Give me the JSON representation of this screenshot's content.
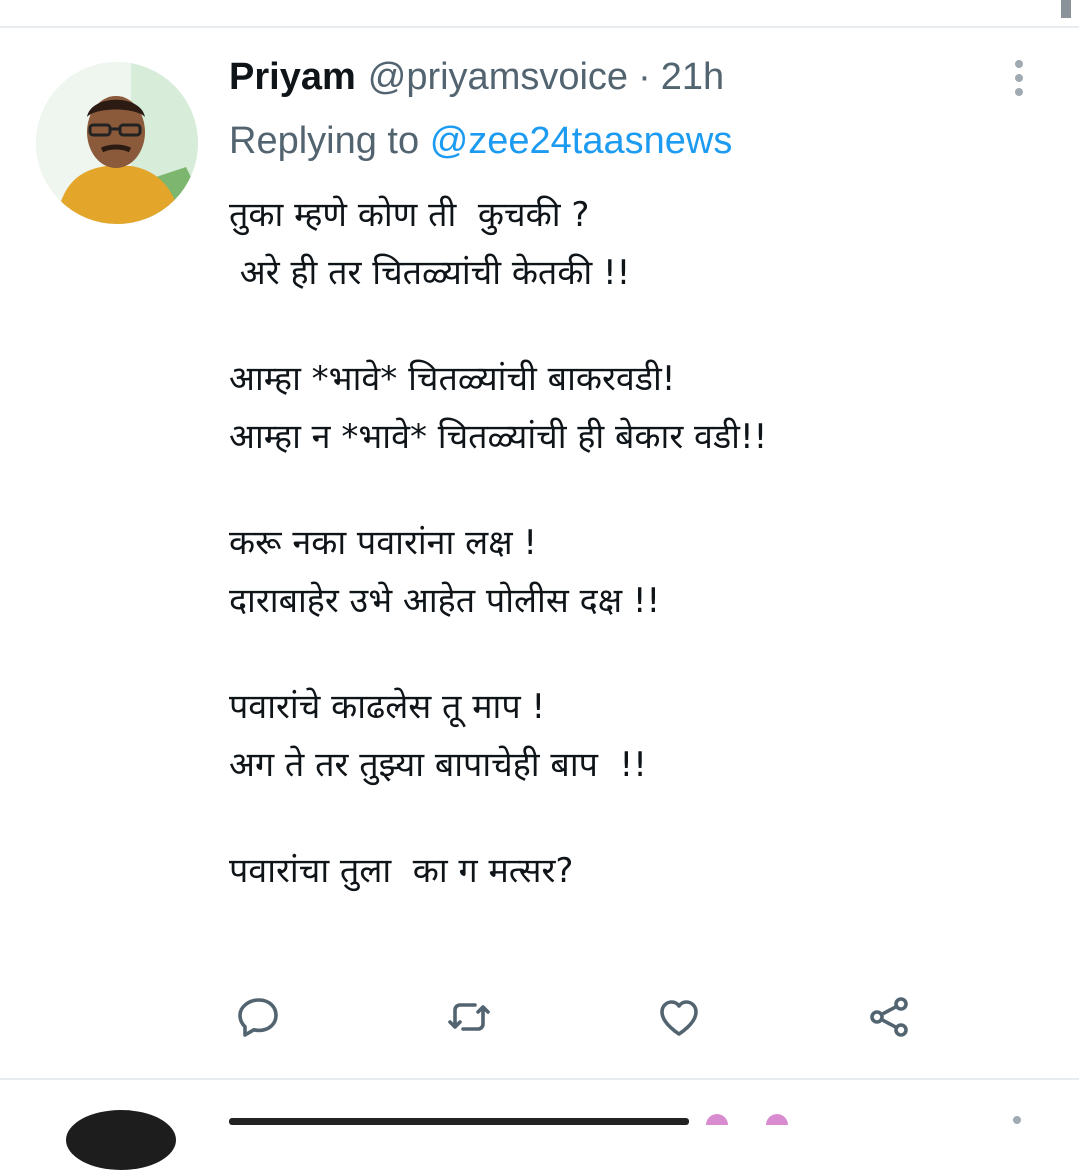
{
  "tweet": {
    "author_name": "Priyam",
    "author_handle": "@priyamsvoice",
    "separator": "·",
    "time_ago": "21h",
    "reply_prefix": "Replying to",
    "reply_to": "@zee24taasnews",
    "lines": [
      "तुका म्हणे कोण ती  कुचकी ?",
      " अरे ही तर चितळ्यांची केतकी !!",
      "",
      "आम्हा *भावे* चितळ्यांची बाकरवडी!",
      "आम्हा न *भावे* चितळ्यांची ही बेकार वडी!!",
      "",
      "करू नका पवारांना लक्ष !",
      "दाराबाहेर उभे आहेत पोलीस दक्ष !!",
      "",
      "पवारांचे काढलेस तू माप !",
      "अग ते तर तुझ्या बापाचेही बाप  !!",
      "",
      "पवारांचा तुला  का ग मत्सर?"
    ]
  },
  "icons": {
    "more": "more-vertical-icon",
    "reply": "reply-icon",
    "retweet": "retweet-icon",
    "like": "heart-icon",
    "share": "share-icon"
  },
  "colors": {
    "text": "#0f1419",
    "secondary": "#536471",
    "link": "#1d9bf0",
    "divider": "#e6ecf0"
  }
}
